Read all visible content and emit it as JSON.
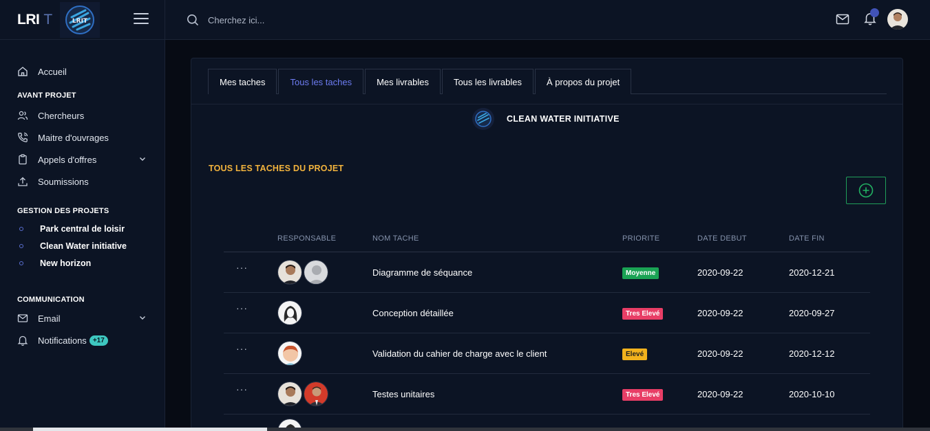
{
  "brand": {
    "name": "LRI",
    "suffix": "T",
    "logo_text": "LRIT"
  },
  "search": {
    "placeholder": "Cherchez ici..."
  },
  "sidebar": {
    "home": "Accueil",
    "sections": {
      "avant": "AVANT PROJET",
      "gestion": "GESTION DES PROJETS",
      "communication": "COMMUNICATION"
    },
    "avant_items": [
      "Chercheurs",
      "Maitre d'ouvrages",
      "Appels d'offres",
      "Soumissions"
    ],
    "projects": [
      "Park central de loisir",
      "Clean Water initiative",
      "New horizon"
    ],
    "comm_items": [
      "Email",
      "Notifications"
    ],
    "notif_badge": "+17"
  },
  "tabs": [
    "Mes taches",
    "Tous les taches",
    "Mes livrables",
    "Tous les livrables",
    "À propos du projet"
  ],
  "active_tab": "Tous les taches",
  "project": {
    "name": "CLEAN WATER INITIATIVE"
  },
  "section_title": "TOUS LES TACHES DU PROJET",
  "table": {
    "headers": {
      "resp": "RESPONSABLE",
      "name": "NOM TACHE",
      "prio": "PRIORITE",
      "deb": "DATE DEBUT",
      "fin": "DATE FIN"
    },
    "rows": [
      {
        "actions": "···",
        "name": "Diagramme de séquance",
        "priority": "Moyenne",
        "start": "2020-09-22",
        "end": "2020-12-21"
      },
      {
        "actions": "···",
        "name": "Conception détaillée",
        "priority": "Tres Elevé",
        "start": "2020-09-22",
        "end": "2020-09-27"
      },
      {
        "actions": "···",
        "name": "Validation du cahier de charge avec le client",
        "priority": "Elevé",
        "start": "2020-09-22",
        "end": "2020-12-12"
      },
      {
        "actions": "···",
        "name": "Testes unitaires",
        "priority": "Tres Elevé",
        "start": "2020-09-22",
        "end": "2020-10-10"
      }
    ]
  },
  "colors": {
    "accent": "#6d7cf2",
    "section_title": "#f2b33d",
    "priority_moyenne": "#1aa354",
    "priority_tres_eleve": "#e83e66",
    "priority_eleve": "#f2b21d",
    "add_button": "#20a05a"
  }
}
